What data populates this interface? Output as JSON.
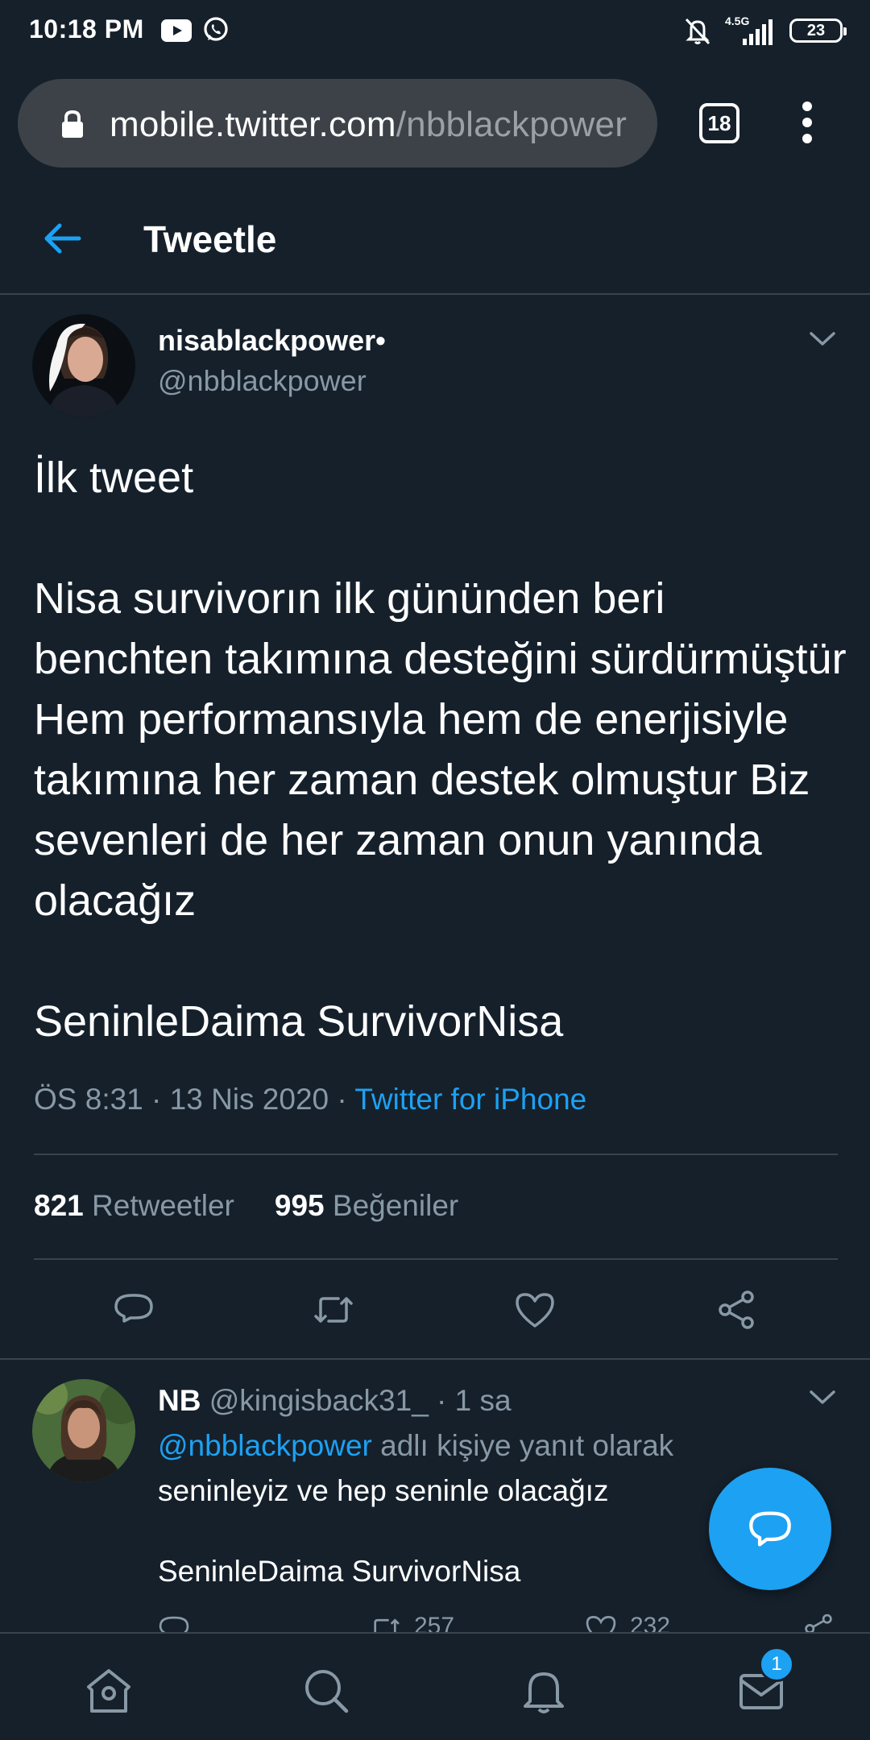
{
  "status_bar": {
    "time": "10:18 PM",
    "network": "4.5G",
    "battery": "23",
    "icons": [
      "youtube-icon",
      "whatsapp-icon",
      "bell-off-icon",
      "signal-icon",
      "battery-icon"
    ]
  },
  "browser": {
    "url_host": "mobile.twitter.com",
    "url_path": "/nbblackpower",
    "tab_count": "18"
  },
  "header": {
    "title": "Tweetle"
  },
  "tweet": {
    "author_name": "nisablackpower•",
    "author_handle": "@nbblackpower",
    "text": "İlk tweet\n\nNisa survivorın ilk gününden beri benchten takımına desteğini sürdürmüştür Hem performansıyla hem de enerjisiyle takımına her zaman destek olmuştur Biz sevenleri de her zaman onun yanında olacağız\n\nSeninleDaima SurvivorNisa",
    "meta": "ÖS 8:31 · 13 Nis 2020 · ",
    "source": "Twitter for iPhone",
    "retweet_count": "821",
    "retweet_label": "Retweetler",
    "like_count": "995",
    "like_label": "Beğeniler"
  },
  "reply": {
    "name": "NB",
    "handle_time": "@kingisback31_ · 1 sa",
    "mention": "@nbblackpower",
    "reply_to_suffix": " adlı kişiye yanıt olarak",
    "text": "seninleyiz ve hep seninle olacağız\n\nSeninleDaima SurvivorNisa",
    "retweet_count": "257",
    "like_count": "232"
  },
  "bottom_nav": {
    "items": [
      "home-icon",
      "search-icon",
      "notifications-icon",
      "messages-icon"
    ],
    "messages_badge": "1"
  },
  "colors": {
    "background": "#15202b",
    "accent": "#1da1f2",
    "secondary_text": "#8899a6",
    "divider": "#38444d"
  }
}
